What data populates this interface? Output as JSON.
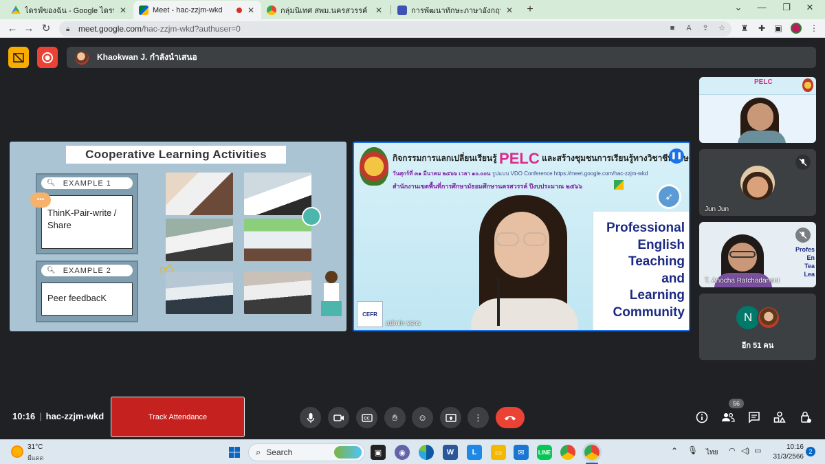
{
  "browser": {
    "tabs": [
      {
        "title": "ไดรฟ์ของฉัน - Google ไดรฟ์",
        "icon": "google-drive-icon"
      },
      {
        "title": "Meet - hac-zzjm-wkd",
        "icon": "google-meet-icon",
        "active": true
      },
      {
        "title": "กลุ่มนิเทศ สพม.นครสวรรค์",
        "icon": "chrome-icon"
      },
      {
        "title": "การพัฒนาทักษะภาษาอังกฤษ English",
        "icon": "google-forms-icon"
      }
    ],
    "url_host": "meet.google.com",
    "url_path": "/hac-zzjm-wkd?authuser=0"
  },
  "meet": {
    "presenter_text": "Khaokwan J. กำลังนำเสนอ",
    "left_slide": {
      "title": "Cooperative Learning Activities",
      "example1_label": "EXAMPLE 1",
      "example1_text": "ThinK-Pair-write / Share",
      "example2_label": "EXAMPLE 2",
      "example2_text": "Peer feedbacK"
    },
    "right_slide": {
      "line1_prefix": "กิจกรรมการแลกเปลี่ยนเรียนรู้",
      "pelc": "PELC",
      "line1_suffix": "และสร้างชุมชนการเรียนรู้ทางวิชาชีพภาษาอังกฤษ",
      "line2_date": "วันศุกร์ที่ ๓๑ มีนาคม ๒๕๖๖ เวลา ๑๐.๐๐น",
      "line2_rest": "รูปแบบ VDO Conference https://meet.google.com/hac-zzjm-wkd",
      "line3": "สำนักงานเขตพื้นที่การศึกษามัธยมศึกษานครสวรรค์ ปีงบประมาณ ๒๕๖๖",
      "words": [
        "Professional",
        "English",
        "Teaching",
        "and",
        "Learning",
        "Community"
      ],
      "participant_name": "admin ssns",
      "cefr_label": "CEFR"
    },
    "tiles": [
      {
        "name": ""
      },
      {
        "name": "Jun Jun"
      },
      {
        "name": "T. Anocha Ratchadanont"
      },
      {
        "avatar_letter": "N",
        "more_text": "อีก 51 คน"
      }
    ],
    "clock": "10:16",
    "meeting_code": "hac-zzjm-wkd",
    "track_attendance": "Track Attendance",
    "participant_count": "56"
  },
  "taskbar": {
    "weather_temp": "31°C",
    "weather_desc": "มีแดด",
    "search_label": "Search",
    "lang": "ไทย",
    "time": "10:16",
    "date": "31/3/2566",
    "notif_count": "2"
  },
  "colors": {
    "meet_bg": "#202124",
    "end_call": "#ea4335",
    "track_btn": "#c5221f",
    "tab_strip": "#d7ecd8",
    "pelc_pink": "#e0288a",
    "navy_text": "#1c2a84"
  }
}
